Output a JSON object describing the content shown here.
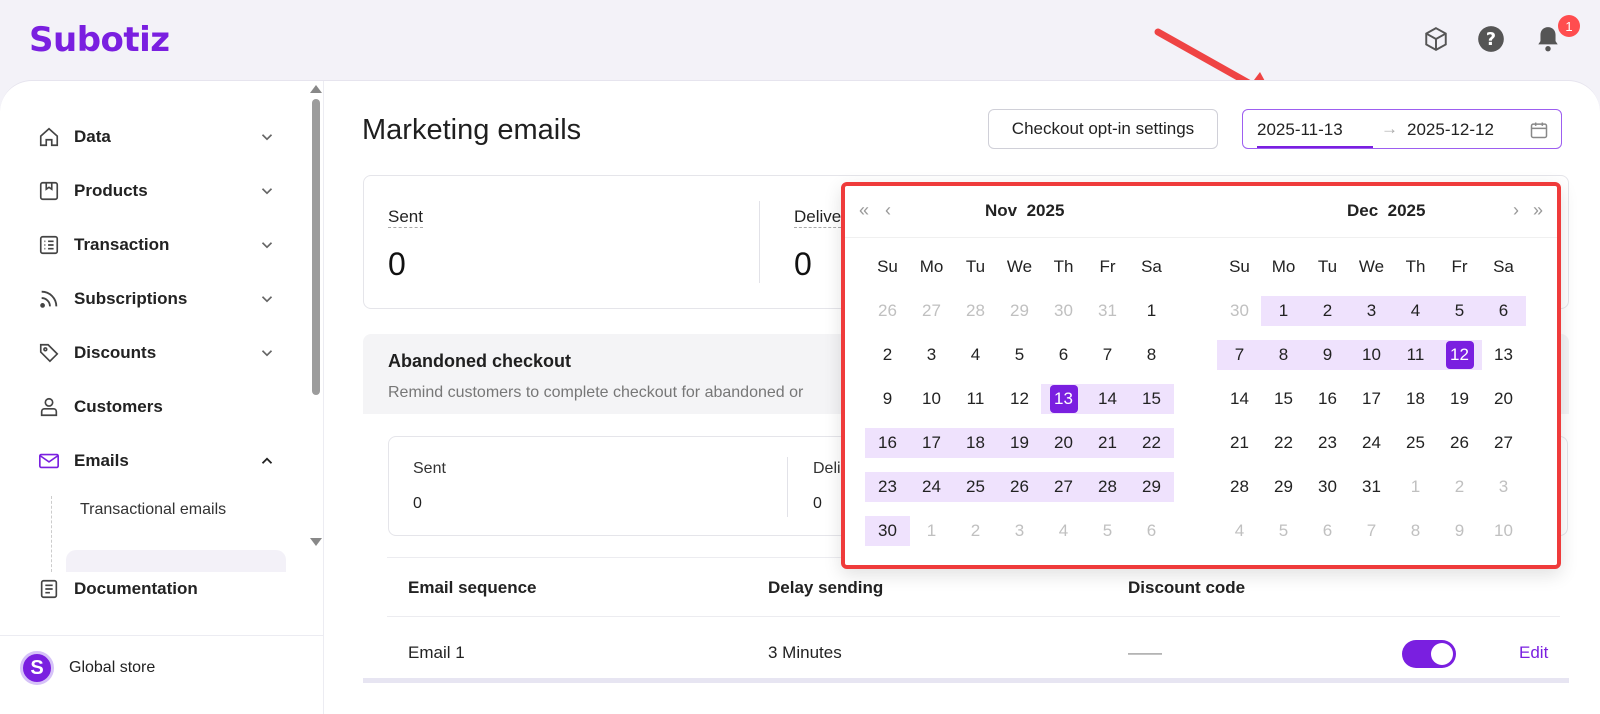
{
  "app": {
    "logo": "Subotiz"
  },
  "topbar": {
    "notification_count": "1"
  },
  "sidebar": {
    "items": [
      {
        "label": "Data",
        "icon": "home-icon"
      },
      {
        "label": "Products",
        "icon": "box-icon"
      },
      {
        "label": "Transaction",
        "icon": "list-icon"
      },
      {
        "label": "Subscriptions",
        "icon": "rss-icon"
      },
      {
        "label": "Discounts",
        "icon": "tag-icon"
      },
      {
        "label": "Customers",
        "icon": "user-icon"
      },
      {
        "label": "Emails",
        "icon": "mail-icon"
      },
      {
        "label": "Documentation",
        "icon": "doc-icon"
      }
    ],
    "sub_items": [
      {
        "label": "Transactional emails"
      }
    ],
    "store": {
      "initial": "S",
      "name": "Global store"
    }
  },
  "main": {
    "title": "Marketing emails",
    "optin_button": "Checkout opt-in settings",
    "range": {
      "start": "2025-11-13",
      "end": "2025-12-12",
      "arrow": "→"
    },
    "stats": [
      {
        "label": "Sent",
        "value": "0"
      },
      {
        "label": "Delive",
        "value": "0"
      }
    ],
    "abandoned": {
      "title": "Abandoned checkout",
      "description": "Remind customers to complete checkout for abandoned or",
      "stats": [
        {
          "label": "Sent",
          "value": "0"
        },
        {
          "label": "Deli",
          "value": "0"
        }
      ],
      "table": {
        "headers": [
          "Email sequence",
          "Delay sending",
          "Discount code"
        ],
        "rows": [
          {
            "sequence": "Email 1",
            "delay": "3 Minutes",
            "discount": "——",
            "enabled": true,
            "action": "Edit"
          }
        ]
      }
    }
  },
  "picker": {
    "weekdays": [
      "Su",
      "Mo",
      "Tu",
      "We",
      "Th",
      "Fr",
      "Sa"
    ],
    "left": {
      "month": "Nov",
      "year": "2025",
      "weeks": [
        [
          "26",
          "27",
          "28",
          "29",
          "30",
          "31",
          "1"
        ],
        [
          "2",
          "3",
          "4",
          "5",
          "6",
          "7",
          "8"
        ],
        [
          "9",
          "10",
          "11",
          "12",
          "13",
          "14",
          "15"
        ],
        [
          "16",
          "17",
          "18",
          "19",
          "20",
          "21",
          "22"
        ],
        [
          "23",
          "24",
          "25",
          "26",
          "27",
          "28",
          "29"
        ],
        [
          "30",
          "1",
          "2",
          "3",
          "4",
          "5",
          "6"
        ]
      ]
    },
    "right": {
      "month": "Dec",
      "year": "2025",
      "weeks": [
        [
          "30",
          "1",
          "2",
          "3",
          "4",
          "5",
          "6"
        ],
        [
          "7",
          "8",
          "9",
          "10",
          "11",
          "12",
          "13"
        ],
        [
          "14",
          "15",
          "16",
          "17",
          "18",
          "19",
          "20"
        ],
        [
          "21",
          "22",
          "23",
          "24",
          "25",
          "26",
          "27"
        ],
        [
          "28",
          "29",
          "30",
          "31",
          "1",
          "2",
          "3"
        ],
        [
          "4",
          "5",
          "6",
          "7",
          "8",
          "9",
          "10"
        ]
      ]
    },
    "accent": "#7a1fe0",
    "range_bg": "#efe2fd"
  }
}
